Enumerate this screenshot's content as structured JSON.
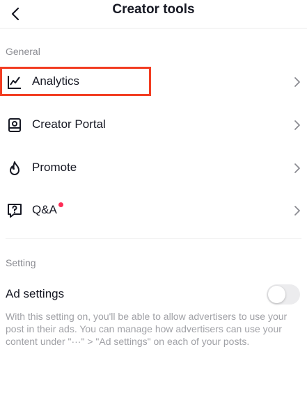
{
  "header": {
    "title": "Creator tools",
    "back_icon": "chevron-left-icon"
  },
  "general": {
    "section_label": "General",
    "items": [
      {
        "label": "Analytics",
        "icon": "analytics-chart-icon",
        "highlighted": true
      },
      {
        "label": "Creator Portal",
        "icon": "creator-portal-book-icon"
      },
      {
        "label": "Promote",
        "icon": "flame-icon"
      },
      {
        "label": "Q&A",
        "icon": "question-bubble-icon",
        "badge": "red-dot"
      }
    ]
  },
  "setting": {
    "section_label": "Setting",
    "ad_settings": {
      "label": "Ad settings",
      "toggle_on": false,
      "description": "With this setting on, you'll be able to allow advertisers to use your post in their ads. You can manage how advertisers can use your content under \"···\" > \"Ad settings\" on each of your posts."
    }
  },
  "colors": {
    "highlight": "#f23d22",
    "badge": "#fe2c55",
    "toggle_off": "#ececee",
    "secondary_text": "#8a8b91"
  }
}
